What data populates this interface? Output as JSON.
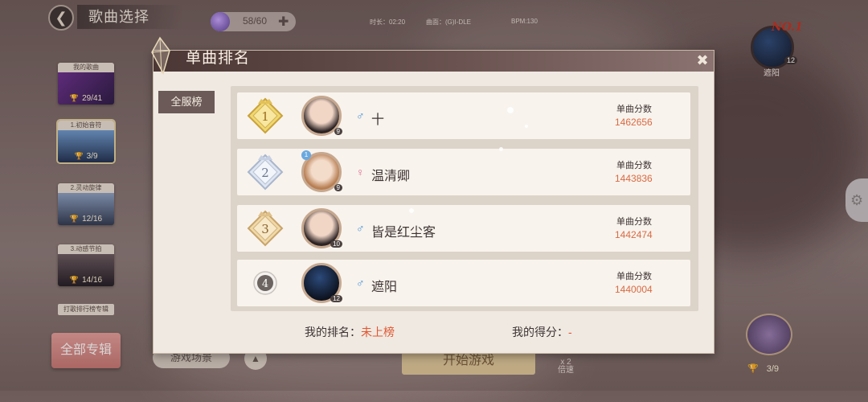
{
  "header": {
    "back_icon": "back-arrow-icon",
    "title": "歌曲选择",
    "stamina": "58/60",
    "song_info": {
      "duration": "时长：02:20",
      "artist": "曲面：(G)I-DLE",
      "bpm": "BPM:130"
    }
  },
  "albums": [
    {
      "label": "我的歌曲",
      "count": "29/41",
      "color": "#5b2d7a"
    },
    {
      "label": "1.初始音符",
      "count": "3/9",
      "color": "#3b5e8a"
    },
    {
      "label": "2.灵动旋律",
      "count": "12/16",
      "color": "#4a5670"
    },
    {
      "label": "3.动感节拍",
      "count": "14/16",
      "color": "#3e3740"
    }
  ],
  "album_partial_label": "打歌排行榜专辑",
  "all_albums_button": "全部专辑",
  "right_panel": {
    "rank_tag": "NO.1",
    "level": "12",
    "name": "遮阳",
    "chest_count": "3/9"
  },
  "bottom_bar": {
    "scene_button": "游戏场景",
    "start_button": "开始游戏",
    "speed_value": "x 2",
    "speed_label": "倍速"
  },
  "modal": {
    "title": "单曲排名",
    "tab": "全服榜",
    "score_label": "单曲分数",
    "entries": [
      {
        "rank": "1",
        "name": "十",
        "gender": "♂",
        "level": "9",
        "score": "1462656"
      },
      {
        "rank": "2",
        "name": "温清卿",
        "gender": "♀",
        "level": "9",
        "score": "1443836",
        "badge": "1"
      },
      {
        "rank": "3",
        "name": "皆是红尘客",
        "gender": "♂",
        "level": "10",
        "score": "1442474"
      },
      {
        "rank": "4",
        "name": "遮阳",
        "gender": "♂",
        "level": "12",
        "score": "1440004"
      }
    ],
    "my_rank_label": "我的排名：",
    "my_rank_value": "未上榜",
    "my_score_label": "我的得分：",
    "my_score_value": "-"
  },
  "colors": {
    "accent": "#d96a43",
    "gold": "#e7c25a",
    "male": "#3e8fd6",
    "female": "#e06a8f"
  }
}
